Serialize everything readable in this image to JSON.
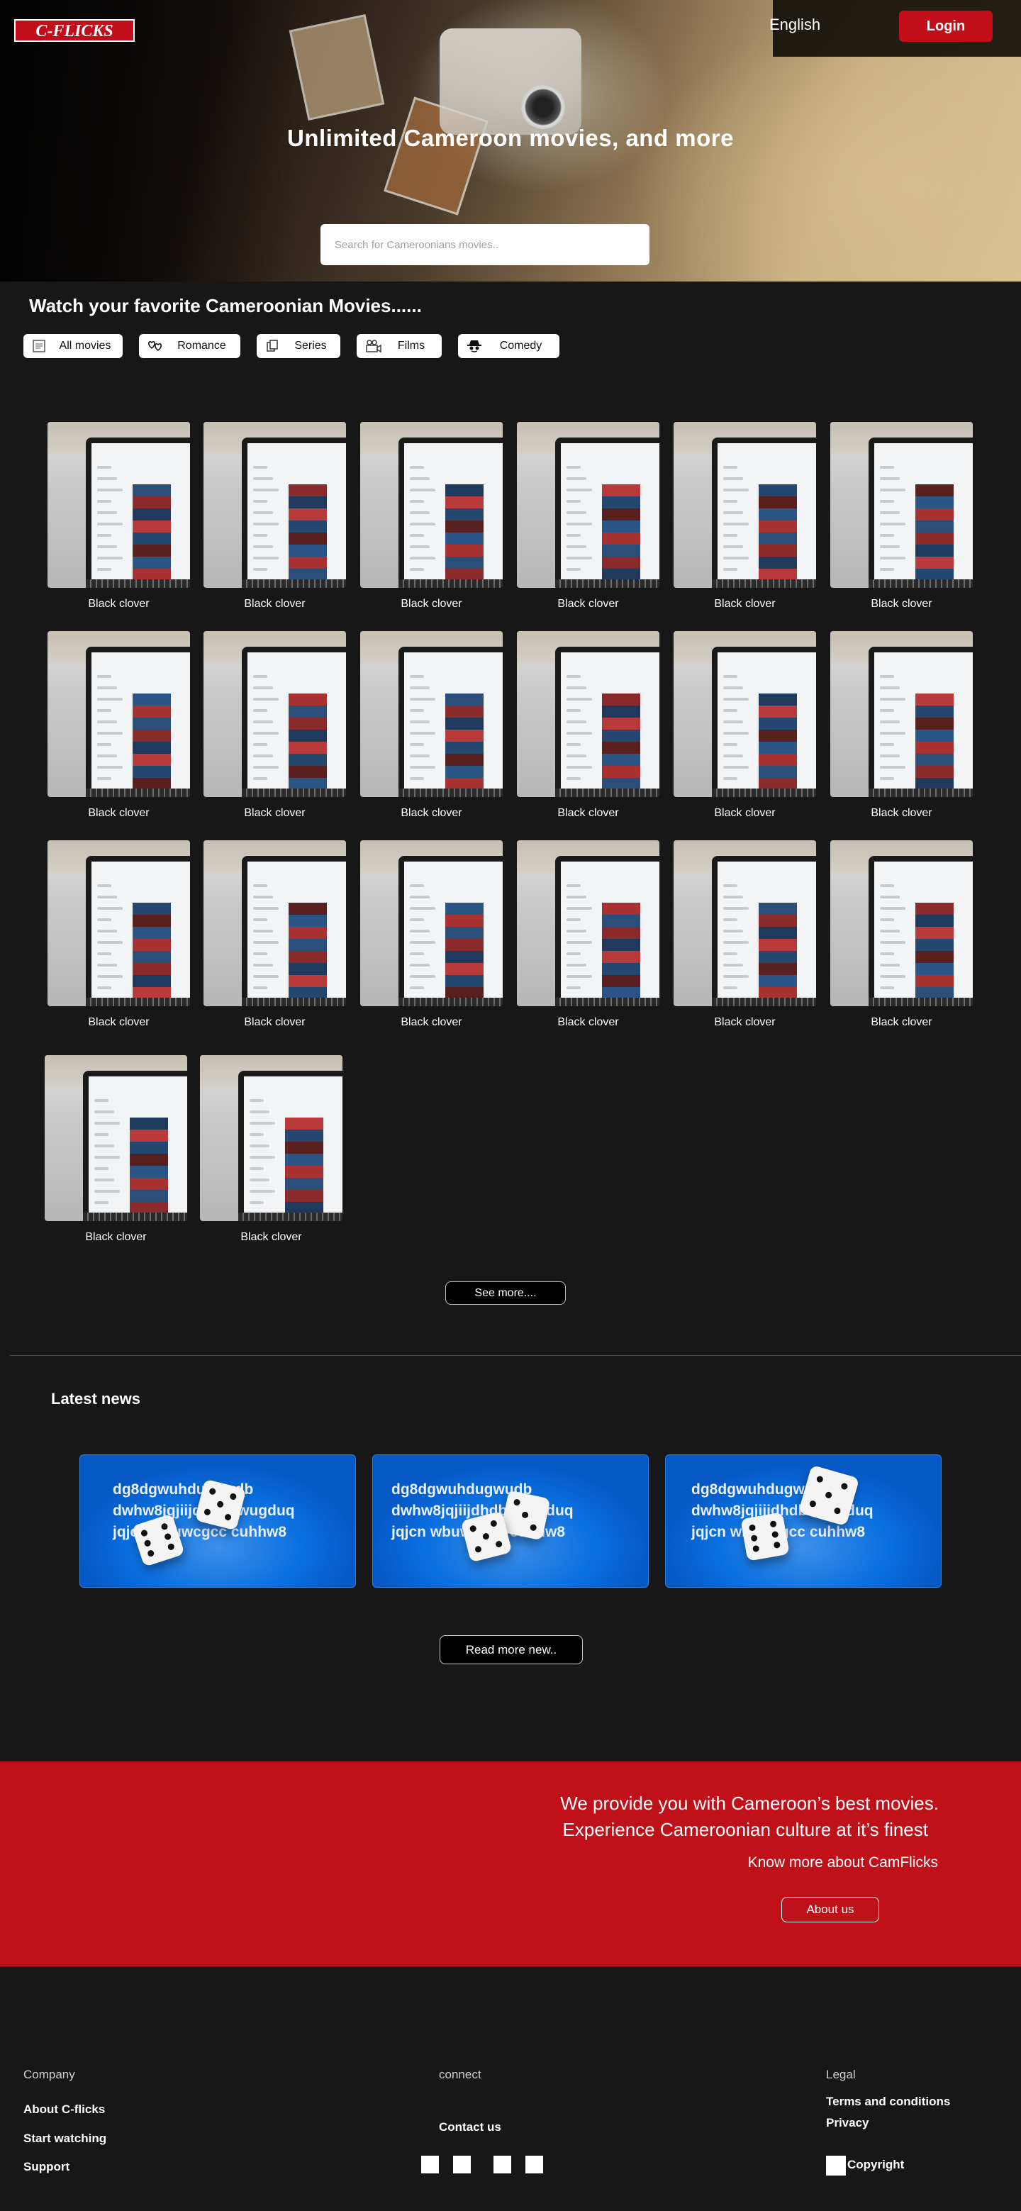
{
  "header": {
    "logo_text": "C-FLICKS",
    "language": "English",
    "login_label": "Login"
  },
  "hero": {
    "title": "Unlimited Cameroon movies, and more",
    "search_placeholder": "Search for Cameroonians movies.."
  },
  "movies_section": {
    "title": "Watch your favorite Cameroonian Movies......",
    "categories": [
      {
        "label": "All movies",
        "icon": "list-icon"
      },
      {
        "label": "Romance",
        "icon": "hearts-icon"
      },
      {
        "label": "Series",
        "icon": "copy-icon"
      },
      {
        "label": "Films",
        "icon": "film-camera-icon"
      },
      {
        "label": "Comedy",
        "icon": "detective-icon"
      }
    ],
    "movies": [
      "Black clover",
      "Black clover",
      "Black clover",
      "Black clover",
      "Black clover",
      "Black clover",
      "Black clover",
      "Black clover",
      "Black clover",
      "Black clover",
      "Black clover",
      "Black clover",
      "Black clover",
      "Black clover",
      "Black clover",
      "Black clover",
      "Black clover",
      "Black clover",
      "Black clover",
      "Black clover"
    ],
    "see_more_label": "See more...."
  },
  "news": {
    "title": "Latest news",
    "items": [
      "dg8dgwuhdugwudb dwhw8jqjiijdhdbdwugduqjqjcn wbuwcgcc cuhhw8",
      "dg8dgwuhdugwudb dwhw8jqjiijdhdbdwugduqjqjcn wbuwcgcc cuhhw8",
      "dg8dgwuhdugwudb dwhw8jqjiijdhdbdwugduqjqjcn wbuwcgcc cuhhw8"
    ],
    "read_more_label": "Read more new.."
  },
  "about_band": {
    "line1": "We provide you with Cameroon’s best movies.",
    "line2": "Experience Cameroonian culture at it’s finest",
    "know_more": "Know more about CamFlicks",
    "about_label": "About us"
  },
  "footer": {
    "company": {
      "heading": "Company",
      "links": [
        "About C-flicks",
        "Start watching",
        "Support"
      ]
    },
    "connect": {
      "heading": "connect",
      "contact": "Contact us",
      "social_icons": [
        "social-icon-1",
        "social-icon-2",
        "social-icon-3",
        "social-icon-4"
      ]
    },
    "legal": {
      "heading": "Legal",
      "links": [
        "Terms and conditions",
        "Privacy"
      ],
      "copyright": "Copyright"
    }
  },
  "colors": {
    "brand_red": "#c20e18",
    "background": "#171717",
    "news_blue": "#0a6fe0"
  }
}
